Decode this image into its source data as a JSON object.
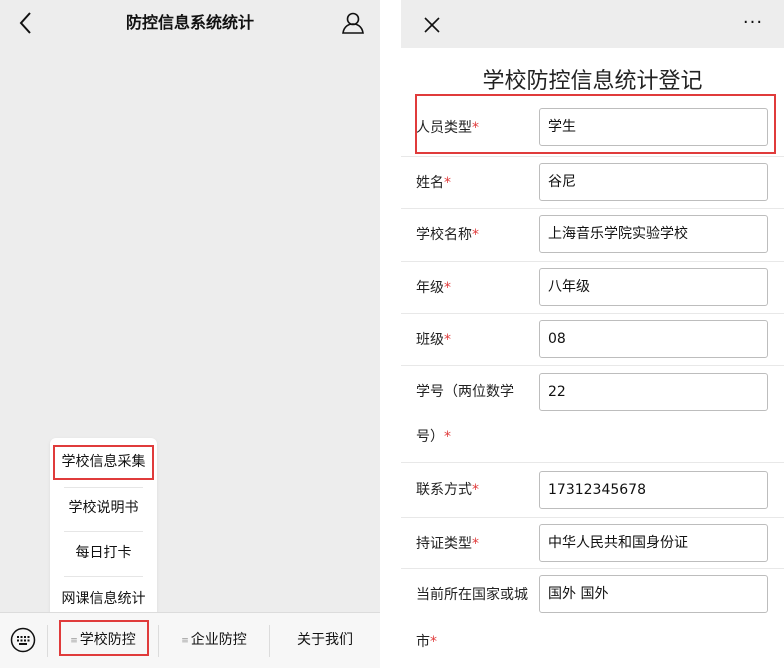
{
  "left": {
    "nav": {
      "title": "防控信息系统统计"
    },
    "popup_menu": {
      "items": [
        "学校信息采集",
        "学校说明书",
        "每日打卡",
        "网课信息统计"
      ]
    },
    "tabbar": {
      "tabs": [
        {
          "label": "学校防控",
          "has_menu": true
        },
        {
          "label": "企业防控",
          "has_menu": true
        },
        {
          "label": "关于我们",
          "has_menu": false
        }
      ],
      "menu_marker": "≡"
    }
  },
  "right": {
    "nav": {
      "more_label": "···"
    },
    "form": {
      "title": "学校防控信息统计登记",
      "fields": [
        {
          "label": "人员类型",
          "required_mark": "*",
          "value": "学生"
        },
        {
          "label": "姓名",
          "required_mark": "*",
          "value": "谷尼"
        },
        {
          "label": "学校名称",
          "required_mark": "*",
          "value": "上海音乐学院实验学校"
        },
        {
          "label": "年级",
          "required_mark": "*",
          "value": "八年级"
        },
        {
          "label": "班级",
          "required_mark": "*",
          "value": "08"
        },
        {
          "label": "学号（两位数学",
          "label_line2": "号）",
          "required_mark": "*",
          "value": "22"
        },
        {
          "label": "联系方式",
          "required_mark": "*",
          "value": "17312345678"
        },
        {
          "label": "持证类型",
          "required_mark": "*",
          "value": "中华人民共和国身份证"
        },
        {
          "label": "当前所在国家或城",
          "label_line2": "市",
          "required_mark": "*",
          "value": "国外 国外"
        }
      ]
    }
  },
  "colors": {
    "highlight": "#e03b3b",
    "required": "#e03b3b",
    "nav_bg": "#ededed"
  }
}
